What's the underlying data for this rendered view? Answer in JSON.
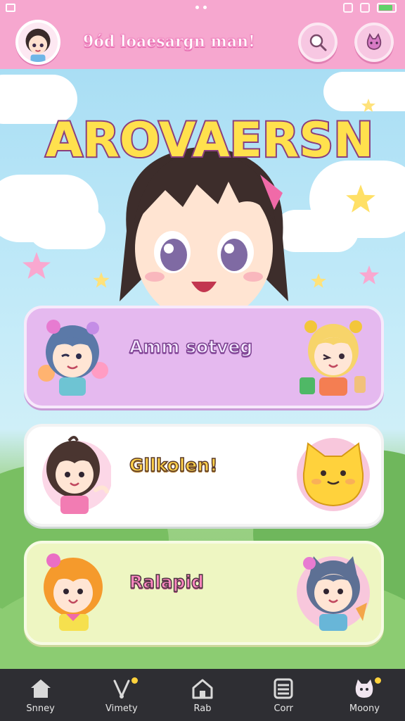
{
  "header": {
    "title": "9ód loaesargn man!"
  },
  "hero": {
    "title": "AROVAERSN"
  },
  "cards": [
    {
      "label": "Amm sotveg"
    },
    {
      "label": "Gllkolen!"
    },
    {
      "label": "Ralapid"
    }
  ],
  "nav": [
    {
      "label": "Snney",
      "icon": "home-icon"
    },
    {
      "label": "Vimety",
      "icon": "heart-pin-icon"
    },
    {
      "label": "Rab",
      "icon": "house-outline-icon"
    },
    {
      "label": "Corr",
      "icon": "list-icon"
    },
    {
      "label": "Moony",
      "icon": "cat-icon"
    }
  ],
  "colors": {
    "header": "#f6a7cf",
    "sky": "#bfe6f6",
    "card_purple": "#e5b9ef",
    "card_white": "#ffffff",
    "card_lime": "#eef6c2",
    "nav_bg": "#2e2e33",
    "accent_yellow": "#ffd23c"
  }
}
